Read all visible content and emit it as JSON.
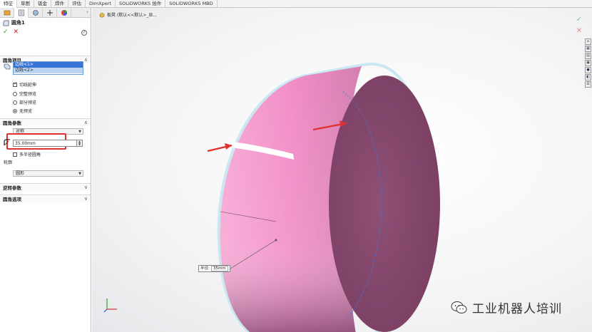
{
  "top_tabs": [
    "特征",
    "草图",
    "钣金",
    "焊件",
    "评估",
    "DimXpert",
    "SOLIDWORKS 插件",
    "SOLIDWORKS MBD"
  ],
  "feature": {
    "title": "圆角1",
    "help": "?",
    "ok": "✓",
    "cancel": "✕"
  },
  "sections": {
    "items_title": "圆角项目",
    "params_title": "圆角参数",
    "reverse_title": "逆转参数",
    "options_title": "圆角选项"
  },
  "selection": [
    "边线<1>",
    "边线<2>"
  ],
  "options": {
    "tangent_propagation": "切线延伸",
    "full_preview": "完整预览",
    "partial_preview": "部分预览",
    "no_preview": "无预览"
  },
  "params": {
    "symmetric": "对称",
    "radius_value": "35.00mm",
    "multi_radius": "多半径圆角",
    "profile_label": "轮廓",
    "profile_value": "圆形"
  },
  "breadcrumb": "板凳 (默认<<默认>_显...",
  "radius_callout": {
    "label": "半径:",
    "value": "35mm"
  },
  "watermark": "工业机器人培训",
  "colors": {
    "ring_pink": "#f48fc4",
    "ring_face": "#8c4d73",
    "arrow_red": "#e03030",
    "accent_blue": "#3874d8"
  }
}
